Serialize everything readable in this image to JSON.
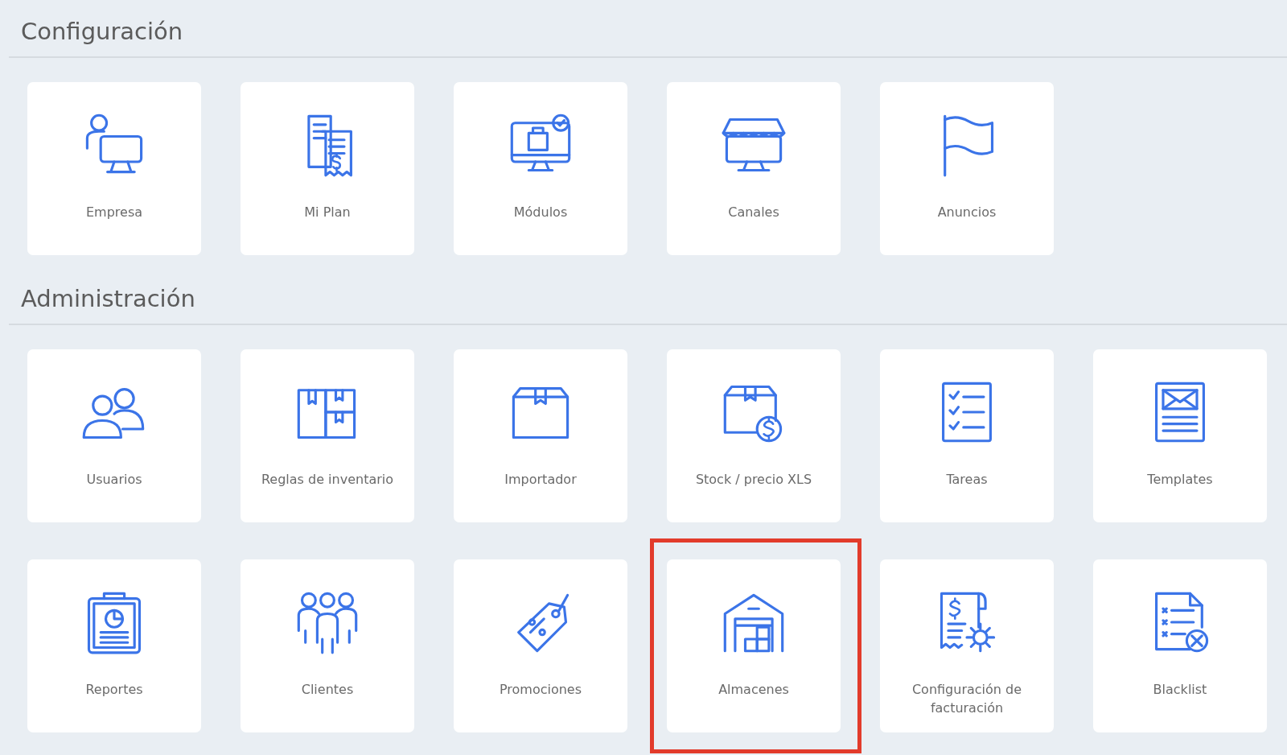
{
  "sections": [
    {
      "title": "Configuración",
      "items": [
        {
          "label": "Empresa",
          "highlighted": false
        },
        {
          "label": "Mi Plan",
          "highlighted": false
        },
        {
          "label": "Módulos",
          "highlighted": false
        },
        {
          "label": "Canales",
          "highlighted": false
        },
        {
          "label": "Anuncios",
          "highlighted": false
        }
      ]
    },
    {
      "title": "Administración",
      "items": [
        {
          "label": "Usuarios",
          "highlighted": false
        },
        {
          "label": "Reglas de inventario",
          "highlighted": false
        },
        {
          "label": "Importador",
          "highlighted": false
        },
        {
          "label": "Stock / precio XLS",
          "highlighted": false
        },
        {
          "label": "Tareas",
          "highlighted": false
        },
        {
          "label": "Templates",
          "highlighted": false
        },
        {
          "label": "Reportes",
          "highlighted": false
        },
        {
          "label": "Clientes",
          "highlighted": false
        },
        {
          "label": "Promociones",
          "highlighted": false
        },
        {
          "label": "Almacenes",
          "highlighted": true
        },
        {
          "label": "Configuración de facturación",
          "highlighted": false
        },
        {
          "label": "Blacklist",
          "highlighted": false
        }
      ]
    }
  ]
}
